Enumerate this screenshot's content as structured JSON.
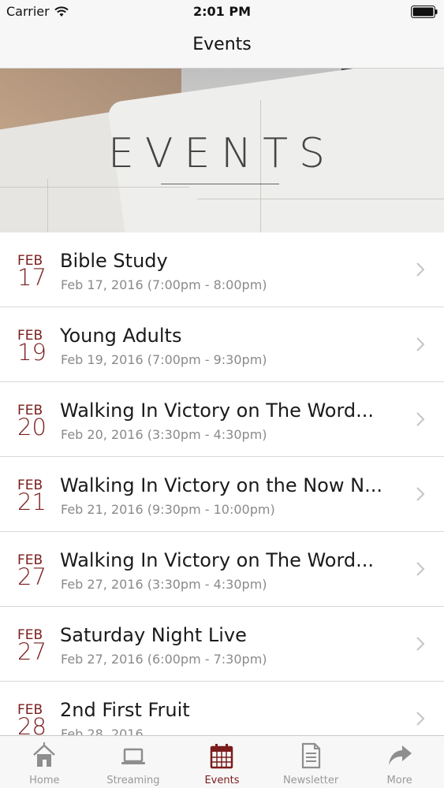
{
  "status_bar": {
    "carrier": "Carrier",
    "time": "2:01 PM"
  },
  "nav": {
    "title": "Events"
  },
  "hero": {
    "title": "EVENTS"
  },
  "events": [
    {
      "month": "FEB",
      "day": "17",
      "title": "Bible Study",
      "subtitle": "Feb 17, 2016 (7:00pm - 8:00pm)"
    },
    {
      "month": "FEB",
      "day": "19",
      "title": "Young Adults",
      "subtitle": "Feb 19, 2016 (7:00pm - 9:30pm)"
    },
    {
      "month": "FEB",
      "day": "20",
      "title": "Walking In Victory on The Word...",
      "subtitle": "Feb 20, 2016 (3:30pm - 4:30pm)"
    },
    {
      "month": "FEB",
      "day": "21",
      "title": "Walking In Victory on the Now N...",
      "subtitle": "Feb 21, 2016 (9:30pm - 10:00pm)"
    },
    {
      "month": "FEB",
      "day": "27",
      "title": "Walking In Victory on The Word...",
      "subtitle": "Feb 27, 2016 (3:30pm - 4:30pm)"
    },
    {
      "month": "FEB",
      "day": "27",
      "title": "Saturday Night Live",
      "subtitle": "Feb 27, 2016 (6:00pm - 7:30pm)"
    },
    {
      "month": "FEB",
      "day": "28",
      "title": "2nd First Fruit",
      "subtitle": "Feb 28, 2016"
    }
  ],
  "tabs": [
    {
      "label": "Home",
      "icon": "home-icon",
      "active": false
    },
    {
      "label": "Streaming",
      "icon": "laptop-icon",
      "active": false
    },
    {
      "label": "Events",
      "icon": "calendar-icon",
      "active": true
    },
    {
      "label": "Newsletter",
      "icon": "document-icon",
      "active": false
    },
    {
      "label": "More",
      "icon": "share-arrow-icon",
      "active": false
    }
  ],
  "colors": {
    "accent": "#7b1d1d",
    "inactive_tab": "#999999",
    "bar_background": "#f7f7f7"
  }
}
